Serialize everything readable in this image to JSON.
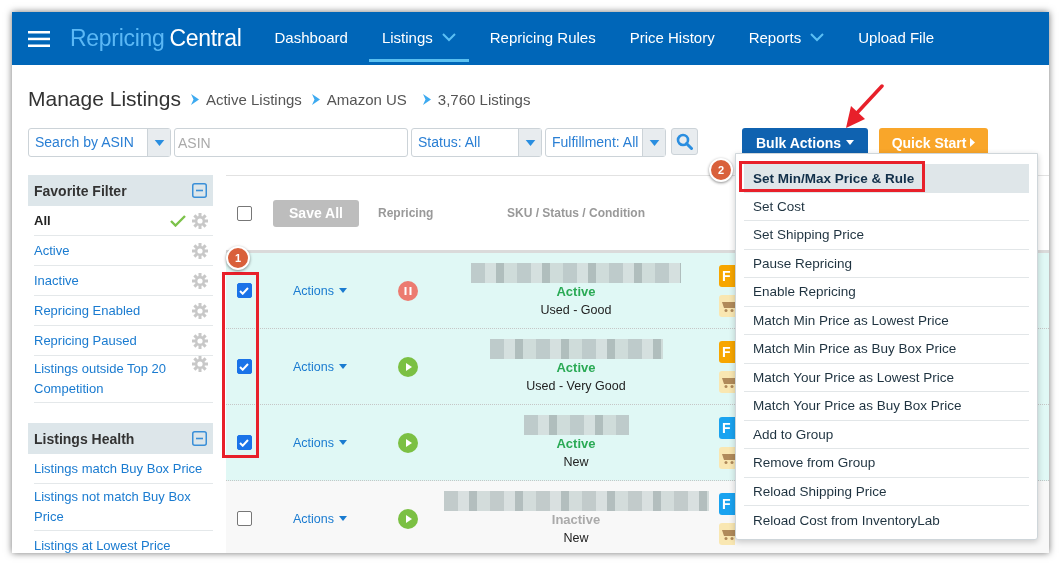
{
  "nav": {
    "brand": {
      "first": "Repricing",
      "second": "Central"
    },
    "items": [
      {
        "label": "Dashboard",
        "selected": false,
        "dropdown": false
      },
      {
        "label": "Listings",
        "selected": true,
        "dropdown": true
      },
      {
        "label": "Repricing Rules",
        "selected": false,
        "dropdown": false
      },
      {
        "label": "Price History",
        "selected": false,
        "dropdown": false
      },
      {
        "label": "Reports",
        "selected": false,
        "dropdown": true
      },
      {
        "label": "Upload File",
        "selected": false,
        "dropdown": false
      }
    ]
  },
  "breadcrumb": {
    "title": "Manage Listings",
    "crumbs": [
      "Active Listings",
      "Amazon US",
      "3,760 Listings"
    ]
  },
  "filters": {
    "search_by": "Search by ASIN",
    "asin_placeholder": "ASIN",
    "status": "Status: All",
    "fulfillment": "Fulfillment: All",
    "bulk_actions": "Bulk Actions",
    "quick_start": "Quick Start"
  },
  "sidebar": [
    {
      "title": "Favorite Filter",
      "expanded": true,
      "items": [
        {
          "label": "All",
          "selected": true,
          "settings": true
        },
        {
          "label": "Active",
          "selected": false,
          "settings": true
        },
        {
          "label": "Inactive",
          "selected": false,
          "settings": true
        },
        {
          "label": "Repricing Enabled",
          "selected": false,
          "settings": true
        },
        {
          "label": "Repricing Paused",
          "selected": false,
          "settings": true
        },
        {
          "label": "Listings outside Top 20 Competition",
          "selected": false,
          "settings": true
        }
      ]
    },
    {
      "title": "Listings Health",
      "expanded": true,
      "items": [
        {
          "label": "Listings match Buy Box Price",
          "selected": false,
          "settings": false
        },
        {
          "label": "Listings not match Buy Box Price",
          "selected": false,
          "settings": false
        },
        {
          "label": "Listings at Lowest Price",
          "selected": false,
          "settings": false
        }
      ]
    }
  ],
  "table": {
    "select_all": false,
    "save_all": "Save All",
    "columns": [
      "Repricing",
      "SKU / Status / Condition"
    ],
    "rows": [
      {
        "checked": true,
        "actions": "Actions",
        "repricing_paused": true,
        "status": "Active",
        "active": true,
        "condition": "Used - Good",
        "badge": {
          "label": "F",
          "color": "#f7a600"
        }
      },
      {
        "checked": true,
        "actions": "Actions",
        "repricing_paused": false,
        "status": "Active",
        "active": true,
        "condition": "Used - Very Good",
        "badge": {
          "label": "F",
          "color": "#f7a600"
        }
      },
      {
        "checked": true,
        "actions": "Actions",
        "repricing_paused": false,
        "status": "Active",
        "active": true,
        "condition": "New",
        "badge": {
          "label": "F",
          "color": "#1aa3f0"
        }
      },
      {
        "checked": false,
        "actions": "Actions",
        "repricing_paused": false,
        "status": "Inactive",
        "active": false,
        "condition": "New",
        "badge": {
          "label": "F",
          "color": "#1aa3f0"
        }
      }
    ]
  },
  "bulk_menu": {
    "items": [
      {
        "label": "Set Min/Max Price & Rule",
        "selected": true
      },
      {
        "label": "Set Cost",
        "selected": false
      },
      {
        "label": "Set Shipping Price",
        "selected": false
      },
      {
        "label": "Pause Repricing",
        "selected": false
      },
      {
        "label": "Enable Repricing",
        "selected": false
      },
      {
        "label": "Match Min Price as Lowest Price",
        "selected": false
      },
      {
        "label": "Match Min Price as Buy Box Price",
        "selected": false
      },
      {
        "label": "Match Your Price as Lowest Price",
        "selected": false
      },
      {
        "label": "Match Your Price as Buy Box Price",
        "selected": false
      },
      {
        "label": "Add to Group",
        "selected": false
      },
      {
        "label": "Remove from Group",
        "selected": false
      },
      {
        "label": "Reload Shipping Price",
        "selected": false
      },
      {
        "label": "Reload Cost from InventoryLab",
        "selected": false
      }
    ]
  },
  "annotations": {
    "step_markers": [
      "1",
      "2"
    ]
  }
}
